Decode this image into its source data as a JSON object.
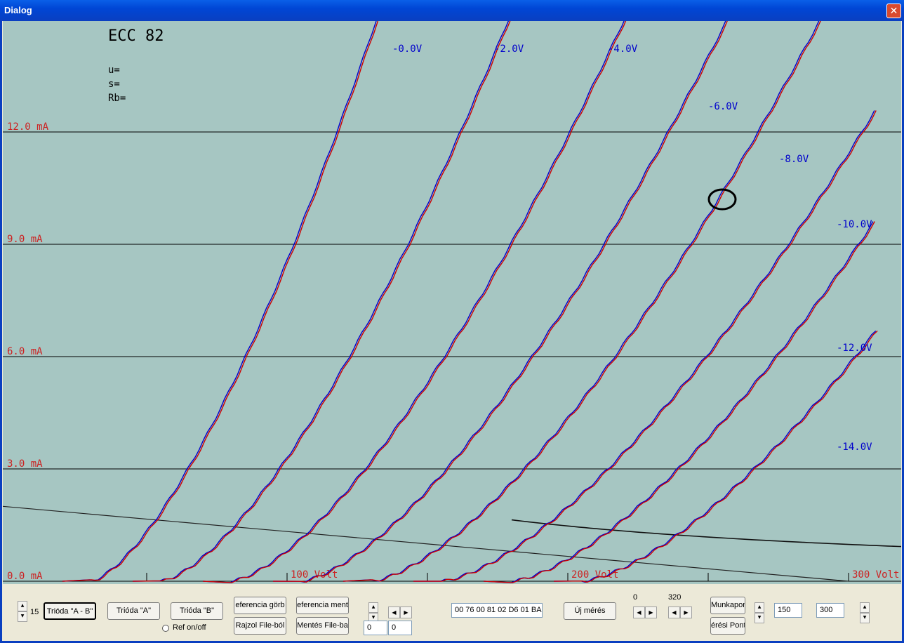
{
  "window": {
    "title": "Dialog",
    "close_glyph": "✕"
  },
  "plot": {
    "tube_title": "ECC 82",
    "params": [
      "u=",
      "s=",
      "Rb="
    ],
    "colors": {
      "background": "#a6c6c2",
      "curve_a": "#0000cc",
      "curve_b": "#cc0000",
      "grid": "#000000",
      "current_label": "#cc2222",
      "grid_label": "#0000cc"
    },
    "current_labels": [
      "12.0 mA",
      "9.0 mA",
      "6.0 mA",
      "3.0 mA",
      "0.0 mA"
    ],
    "voltage_labels": [
      "100 Volt",
      "200 Volt",
      "300 Volt"
    ],
    "grid_voltage_labels": [
      "-0.0V",
      "-2.0V",
      "-4.0V",
      "-6.0V",
      "-8.0V",
      "-10.0V",
      "-12.0V",
      "-14.0V"
    ]
  },
  "chart_data": {
    "type": "line",
    "title": "ECC 82",
    "xlabel": "",
    "ylabel": "",
    "xlim": [
      0,
      300
    ],
    "ylim": [
      0,
      15
    ],
    "x_ticks": [
      "100 Volt",
      "200 Volt",
      "300 Volt"
    ],
    "y_ticks": [
      "0.0 mA",
      "3.0 mA",
      "6.0 mA",
      "9.0 mA",
      "12.0 mA"
    ],
    "grid": true,
    "series": [
      {
        "name": "-0.0V",
        "x0": 30,
        "x12": 118
      },
      {
        "name": "-2.0V",
        "x0": 55,
        "x12": 162
      },
      {
        "name": "-4.0V",
        "x0": 80,
        "x12": 201
      },
      {
        "name": "-6.0V",
        "x0": 105,
        "x12": 236
      },
      {
        "name": "-8.0V",
        "x0": 130,
        "x12": 268
      },
      {
        "name": "-10.0V",
        "x0": 155,
        "x12": 305
      },
      {
        "name": "-12.0V",
        "x0": 180,
        "x12": 330
      },
      {
        "name": "-14.0V",
        "x0": 205,
        "x12": 360
      }
    ],
    "load_line": {
      "from": [
        0,
        2
      ],
      "to": [
        300,
        0
      ]
    },
    "power_hyperbola_mw": 2950,
    "operating_point": [
      255,
      10.2
    ]
  },
  "controls": {
    "spin_value": "15",
    "btn_trioda_ab": "Trióda \"A - B\"",
    "btn_trioda_a": "Trióda  \"A\"",
    "btn_trioda_b": "Trióda  \"B\"",
    "ref_onoff": "Ref on/off",
    "btn_ref_gorbe": "eferencia görb",
    "btn_ref_mentes": "eferencia ment",
    "btn_rajzol": "Rajzol File-ból",
    "btn_mentes": "Mentés File-ba",
    "field_a": "0",
    "field_b": "0",
    "hex_field": "00 76 00 81 02 D6 01 BA",
    "btn_uj_meres": "Új mérés",
    "range_min": "0",
    "range_max": "320",
    "btn_munkapont": "Munkapon",
    "btn_meresi_pont": "érési Pont",
    "field_150": "150",
    "field_300": "300"
  }
}
